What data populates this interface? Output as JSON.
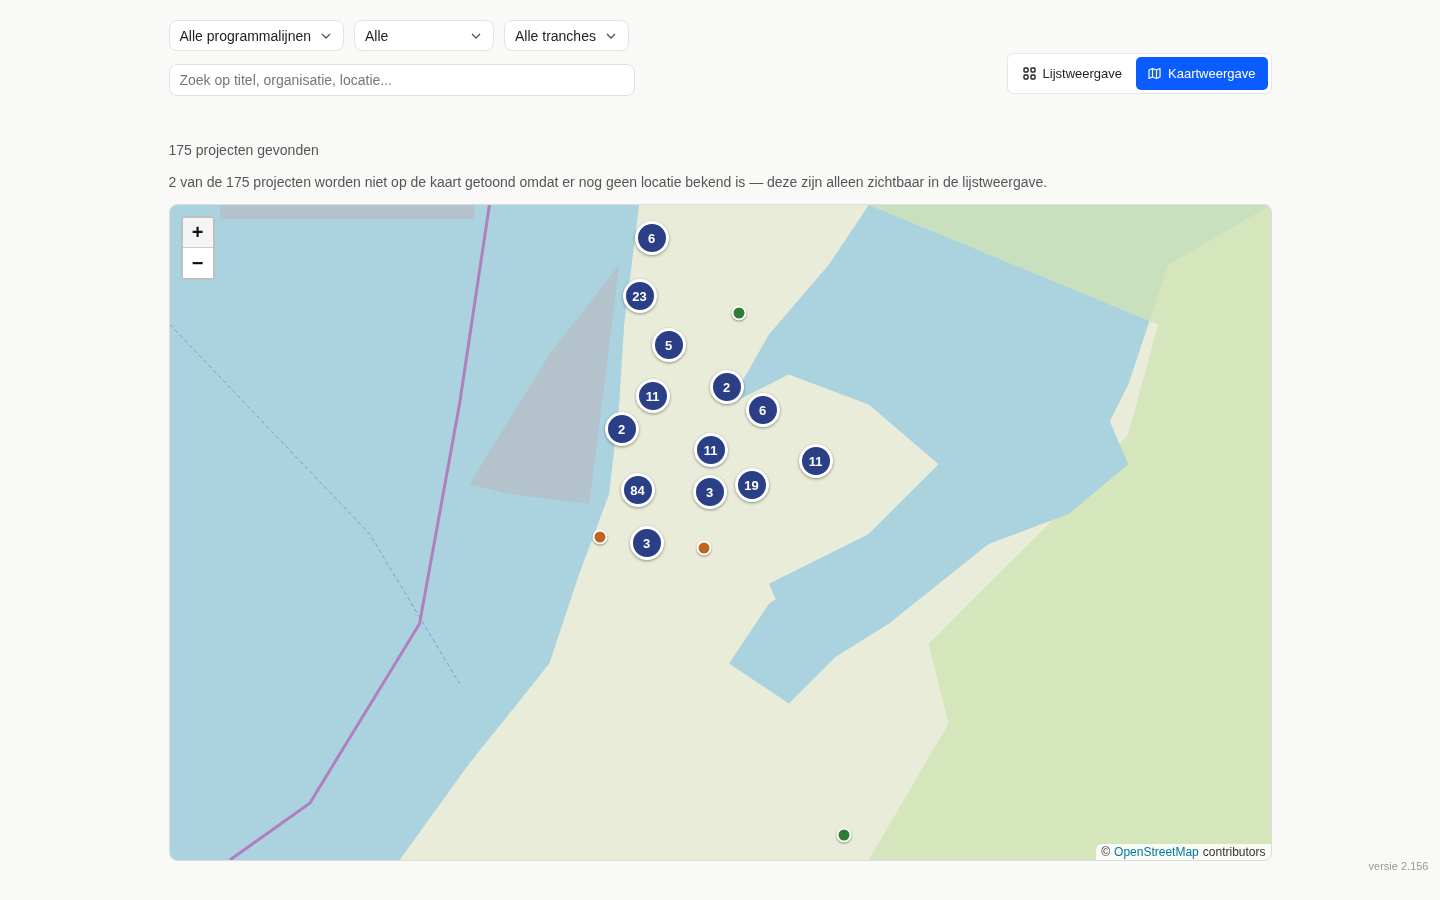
{
  "filters": [
    {
      "value": "Alle programmalijnen"
    },
    {
      "value": "Alle"
    },
    {
      "value": "Alle tranches"
    }
  ],
  "search": {
    "placeholder": "Zoek op titel, organisatie, locatie..."
  },
  "view_toggle": [
    {
      "label": "Lijstweergave",
      "kind": "list",
      "selected": false
    },
    {
      "label": "Kaartweergave",
      "kind": "map",
      "selected": true
    }
  ],
  "result_count": "175 projecten gevonden",
  "notice": "2 van de 175 projecten worden niet op de kaart getoond omdat er nog geen locatie bekend is — deze zijn alleen zichtbaar in de lijstweergave.",
  "map": {
    "zoom_in": "+",
    "zoom_out": "−",
    "markers": [
      {
        "kind": "cluster",
        "count": "6"
      },
      {
        "kind": "cluster",
        "count": "23"
      },
      {
        "kind": "cluster",
        "count": "5"
      },
      {
        "kind": "cluster",
        "count": "2"
      },
      {
        "kind": "cluster",
        "count": "6"
      },
      {
        "kind": "cluster",
        "count": "11"
      },
      {
        "kind": "cluster",
        "count": "2"
      },
      {
        "kind": "cluster",
        "count": "11"
      },
      {
        "kind": "cluster",
        "count": "11"
      },
      {
        "kind": "cluster",
        "count": "19"
      },
      {
        "kind": "cluster",
        "count": "3"
      },
      {
        "kind": "cluster",
        "count": "84"
      },
      {
        "kind": "cluster",
        "count": "3"
      },
      {
        "kind": "point",
        "color": "#2e7d32"
      },
      {
        "kind": "point",
        "color": "#c0651f"
      },
      {
        "kind": "point",
        "color": "#c0651f"
      },
      {
        "kind": "point",
        "color": "#2e7d32"
      }
    ],
    "attribution": {
      "prefix": "©",
      "link": "OpenStreetMap",
      "suffix": "contributors"
    }
  },
  "version": "versie 2.156"
}
